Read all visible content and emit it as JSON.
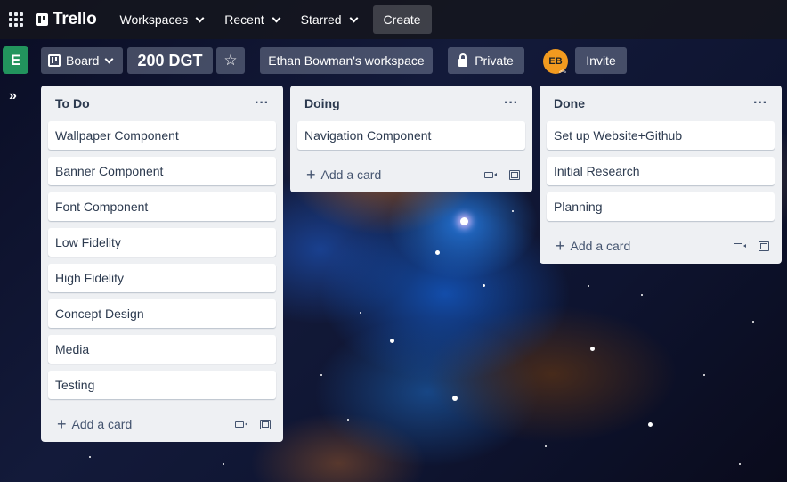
{
  "topnav": {
    "logo": "Trello",
    "menus": [
      "Workspaces",
      "Recent",
      "Starred"
    ],
    "create_label": "Create"
  },
  "board_header": {
    "workspace_initial": "E",
    "view_label": "Board",
    "board_title": "200 DGT",
    "workspace_label": "Ethan Bowman's workspace",
    "visibility_label": "Private",
    "member_initials": "EB",
    "invite_label": "Invite"
  },
  "lists": [
    {
      "title": "To Do",
      "cards": [
        "Wallpaper Component",
        "Banner Component",
        "Font Component",
        "Low Fidelity",
        "High Fidelity",
        "Concept Design",
        "Media",
        "Testing"
      ],
      "add_card_label": "Add a card"
    },
    {
      "title": "Doing",
      "cards": [
        "Navigation Component"
      ],
      "add_card_label": "Add a card"
    },
    {
      "title": "Done",
      "cards": [
        "Set up Website+Github",
        "Initial Research",
        "Planning"
      ],
      "add_card_label": "Add a card"
    }
  ],
  "colors": {
    "workspace_avatar": "#22945d",
    "member_avatar": "#f29a1f",
    "list_bg": "#eef0f3"
  }
}
